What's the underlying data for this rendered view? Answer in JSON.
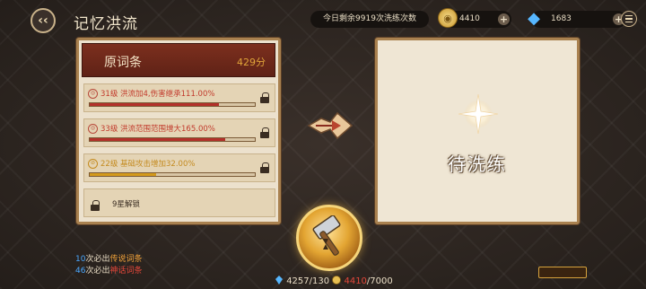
{
  "header": {
    "title": "记忆洪流",
    "wash_count_text": "今日剩余9919次洗练次数"
  },
  "resources": {
    "gold": "4410",
    "gem": "1683"
  },
  "original": {
    "title": "原词条",
    "score": "429分",
    "entries": [
      {
        "text": "31级 洪流加4,伤害继承111.00%",
        "progress": 0.78,
        "color": "red",
        "locked": true
      },
      {
        "text": "33级 洪流范围范围增大165.00%",
        "progress": 0.82,
        "color": "red",
        "locked": true
      },
      {
        "text": "22级 基础攻击增加32.00%",
        "progress": 0.4,
        "color": "gold",
        "locked": true
      }
    ],
    "locked_row": "9星解锁"
  },
  "result": {
    "pending": "待洗练"
  },
  "guarantee": {
    "legend_count": "10",
    "legend_mid": "次必出",
    "legend_name": "传说词条",
    "myth_count": "46",
    "myth_mid": "次必出",
    "myth_name": "神话词条"
  },
  "cost": {
    "a": "4257/130",
    "b_have": "4410",
    "b_need": "/7000"
  },
  "colors": {
    "accent_red": "#b3302a",
    "accent_gold": "#d49a1c",
    "panel_header": "#7c2f1e"
  }
}
